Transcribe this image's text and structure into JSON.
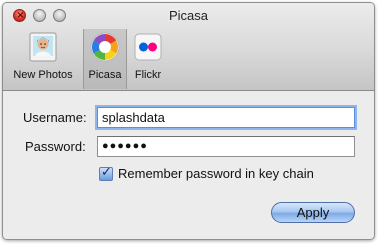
{
  "window": {
    "title": "Picasa"
  },
  "toolbar": {
    "items": [
      {
        "label": "New Photos",
        "icon": "new-photos-icon"
      },
      {
        "label": "Picasa",
        "icon": "picasa-icon"
      },
      {
        "label": "Flickr",
        "icon": "flickr-icon"
      }
    ],
    "selected_index": 1
  },
  "form": {
    "username_label": "Username:",
    "username_value": "splashdata",
    "password_label": "Password:",
    "password_mask": "●●●●●●",
    "remember_label": "Remember password in key chain",
    "remember_checked": true,
    "apply_label": "Apply"
  },
  "colors": {
    "focus_ring": "#8fb5ee",
    "button_blue": "#7eaae6",
    "close_red": "#e0362a",
    "flickr_blue": "#0063dc",
    "flickr_pink": "#ff0084"
  }
}
